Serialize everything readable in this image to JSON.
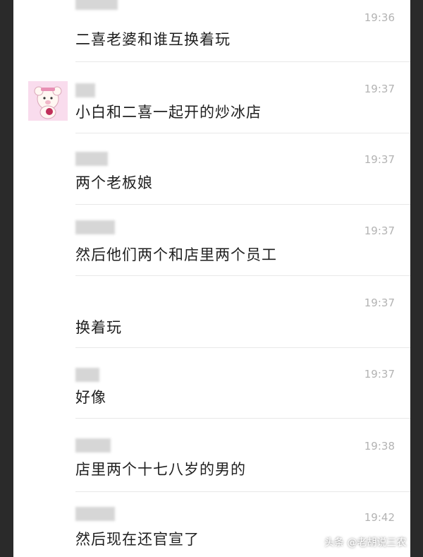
{
  "messages": [
    {
      "time": "19:36",
      "text": "二喜老婆和谁互换着玩"
    },
    {
      "time": "19:37",
      "text": "小白和二喜一起开的炒冰店"
    },
    {
      "time": "19:37",
      "text": "两个老板娘"
    },
    {
      "time": "19:37",
      "text": "然后他们两个和店里两个员工"
    },
    {
      "time": "19:37",
      "text": "换着玩"
    },
    {
      "time": "19:37",
      "text": "好像"
    },
    {
      "time": "19:38",
      "text": "店里两个十七八岁的男的"
    },
    {
      "time": "19:42",
      "text": "然后现在还官宣了"
    }
  ],
  "watermark": "头条 @老胡说三农",
  "avatar_icon": "pink-bear-avatar-icon",
  "colors": {
    "time": "#b3b3b3",
    "text": "#1f1f1f",
    "divider": "#e8e8e8"
  }
}
